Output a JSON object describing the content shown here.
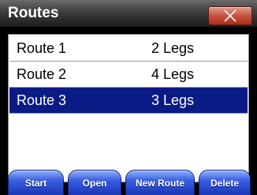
{
  "window": {
    "title": "Routes",
    "close_icon": "close-icon"
  },
  "routes": [
    {
      "name": "Route 1",
      "legs": "2 Legs",
      "selected": false
    },
    {
      "name": "Route 2",
      "legs": "4 Legs",
      "selected": false
    },
    {
      "name": "Route 3",
      "legs": "3 Legs",
      "selected": true
    }
  ],
  "buttons": {
    "start": "Start",
    "open": "Open",
    "new_route": "New Route",
    "delete": "Delete"
  },
  "colors": {
    "selection": "#0a1b86",
    "button": "#2a4cd0",
    "close": "#c7503f"
  }
}
